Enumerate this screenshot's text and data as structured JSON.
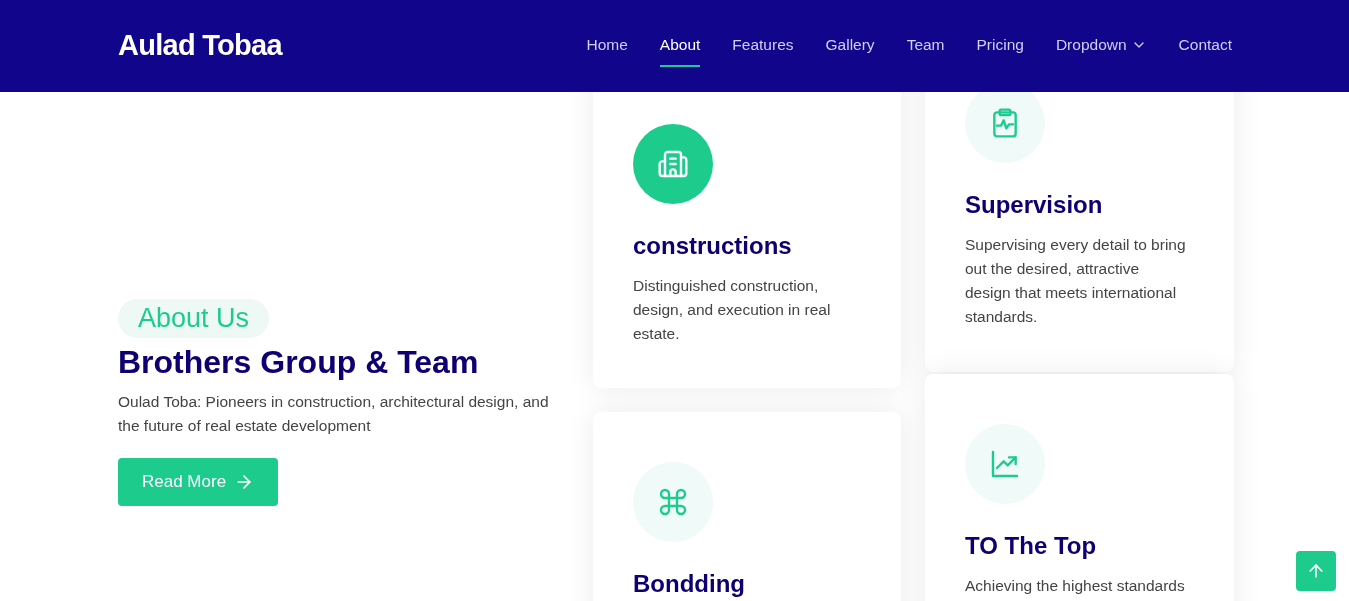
{
  "header": {
    "logo": "Aulad Tobaa",
    "nav": [
      {
        "label": "Home",
        "selected": false,
        "dropdown": false
      },
      {
        "label": "About",
        "selected": true,
        "dropdown": false
      },
      {
        "label": "Features",
        "selected": false,
        "dropdown": false
      },
      {
        "label": "Gallery",
        "selected": false,
        "dropdown": false
      },
      {
        "label": "Team",
        "selected": false,
        "dropdown": false
      },
      {
        "label": "Pricing",
        "selected": false,
        "dropdown": false
      },
      {
        "label": "Dropdown",
        "selected": false,
        "dropdown": true
      },
      {
        "label": "Contact",
        "selected": false,
        "dropdown": false
      }
    ]
  },
  "about": {
    "badge": "About Us",
    "title": "Brothers Group & Team",
    "text": "Oulad Toba: Pioneers in construction, architectural design, and the future of real estate development",
    "button": "Read More"
  },
  "cards": [
    {
      "kind": "building",
      "highlighted": true,
      "title": "constructions",
      "text": "Distinguished construction, design, and execution in real estate."
    },
    {
      "kind": "clipboard",
      "highlighted": false,
      "title": "Supervision",
      "text": "Supervising every detail to bring out the desired, attractive design that meets international standards."
    },
    {
      "kind": "command",
      "highlighted": false,
      "title": "Bondding"
    },
    {
      "kind": "chart",
      "highlighted": false,
      "title": "TO The Top",
      "text": "Achieving the highest standards"
    }
  ]
}
